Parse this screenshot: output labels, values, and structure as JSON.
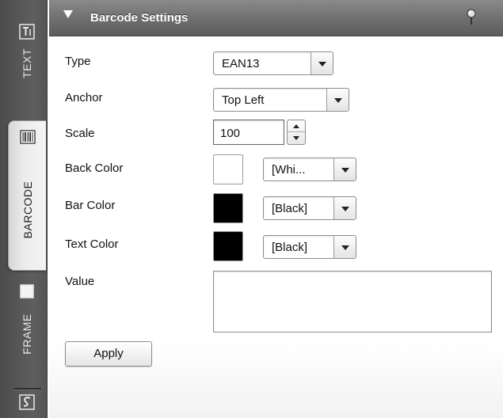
{
  "sidebar": {
    "tabs": [
      {
        "label": "TEXT",
        "icon": "text-icon"
      },
      {
        "label": "BARCODE",
        "icon": "barcode-icon"
      },
      {
        "label": "FRAME",
        "icon": "frame-icon"
      },
      {
        "label": "",
        "icon": "script-icon"
      }
    ]
  },
  "panel": {
    "title": "Barcode Settings"
  },
  "form": {
    "type_label": "Type",
    "type_value": "EAN13",
    "anchor_label": "Anchor",
    "anchor_value": "Top Left",
    "scale_label": "Scale",
    "scale_value": "100",
    "back_color_label": "Back Color",
    "back_color_value": "[Whi...",
    "back_color_hex": "#ffffff",
    "bar_color_label": "Bar Color",
    "bar_color_value": "[Black]",
    "bar_color_hex": "#000000",
    "text_color_label": "Text Color",
    "text_color_value": "[Black]",
    "text_color_hex": "#000000",
    "value_label": "Value",
    "value_text": "",
    "apply_label": "Apply"
  }
}
